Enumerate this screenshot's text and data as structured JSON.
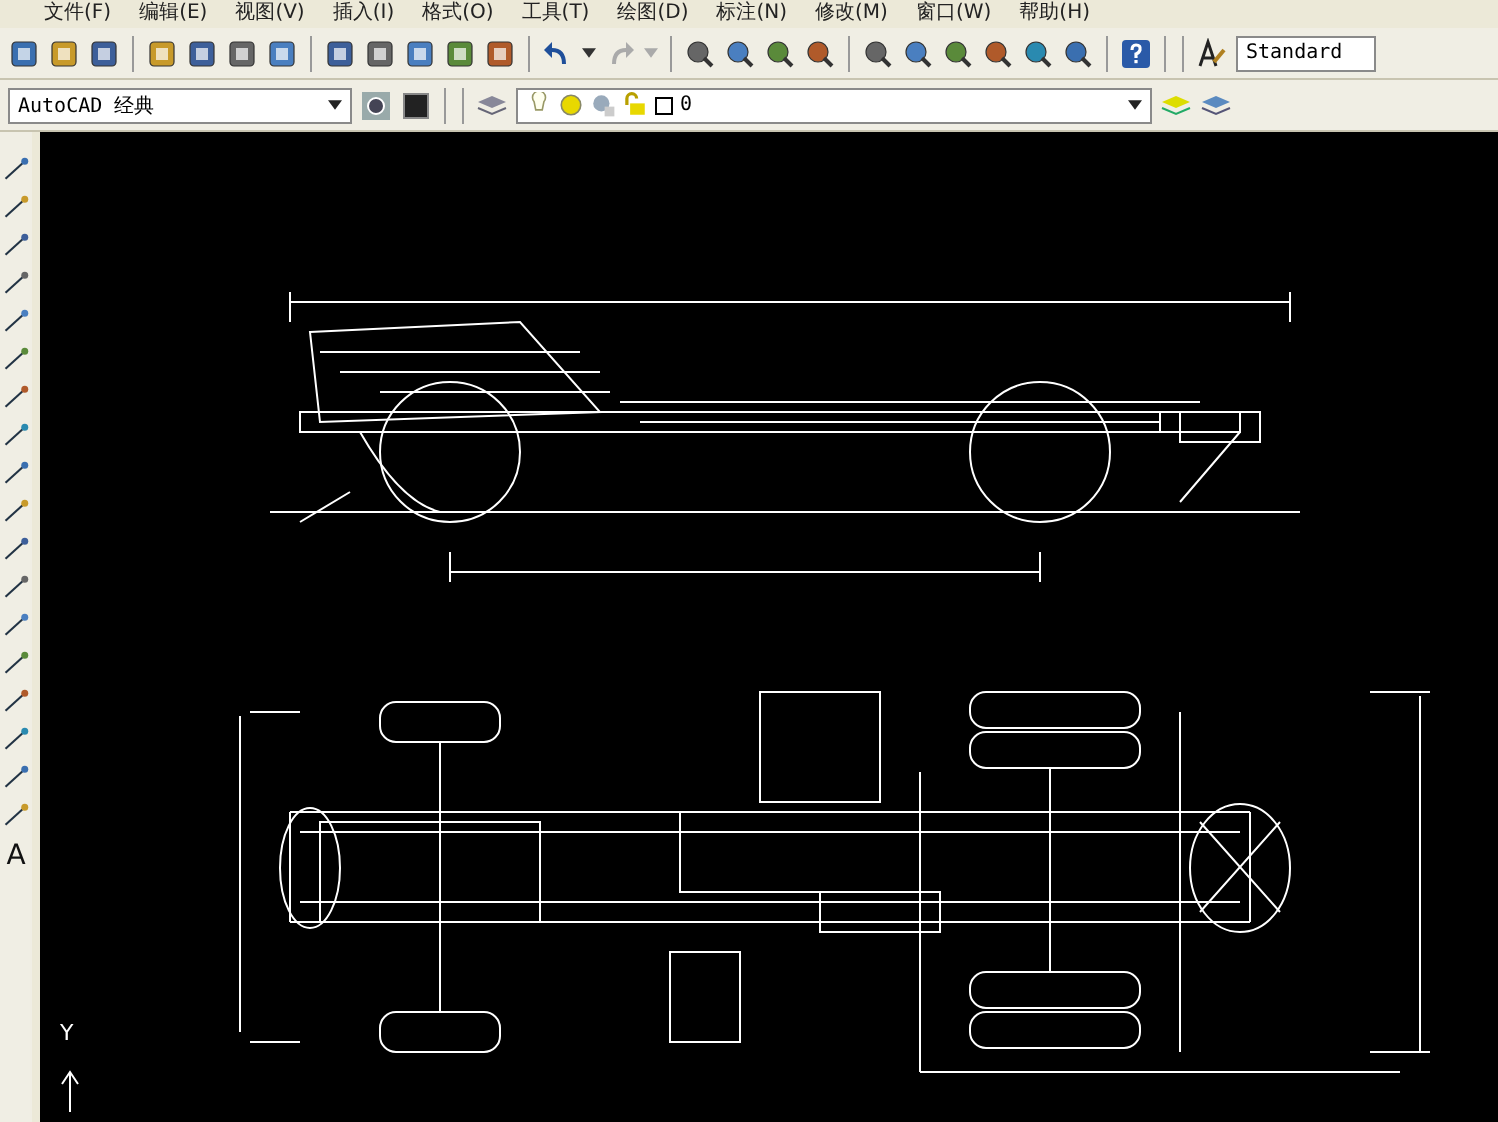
{
  "menu": [
    "文件(F)",
    "编辑(E)",
    "视图(V)",
    "插入(I)",
    "格式(O)",
    "工具(T)",
    "绘图(D)",
    "标注(N)",
    "修改(M)",
    "窗口(W)",
    "帮助(H)"
  ],
  "toolbar": {
    "text_style": "Standard"
  },
  "workspace": {
    "value": "AutoCAD 经典"
  },
  "layer": {
    "value": "0"
  },
  "draw_toolbar": {
    "text_tool": "A"
  },
  "canvas": {
    "ucs_label": "Y"
  }
}
